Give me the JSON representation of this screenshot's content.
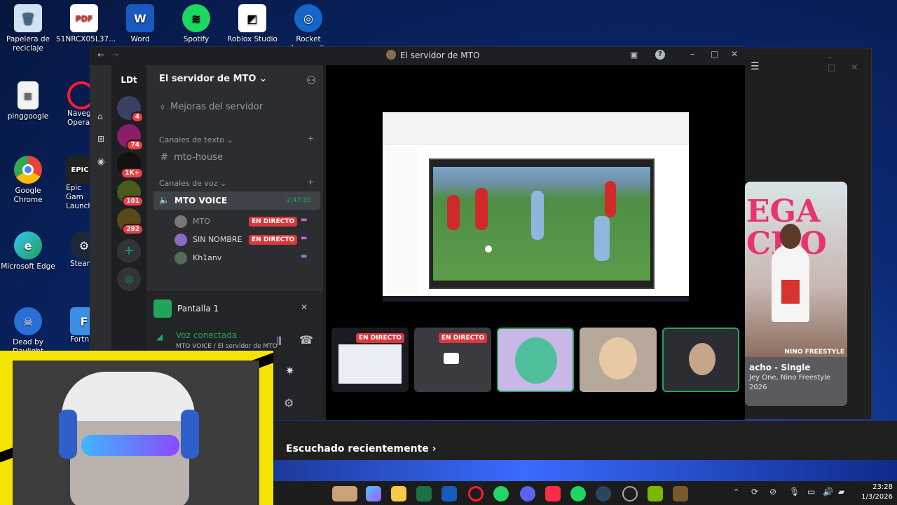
{
  "desktop": {
    "icons": [
      {
        "label": "Papelera de reciclaje"
      },
      {
        "label": "S1NRCX05L37..."
      },
      {
        "label": "Word"
      },
      {
        "label": "Spotify"
      },
      {
        "label": "Roblox Studio"
      },
      {
        "label": "Rocket League®"
      },
      {
        "label": "pinggoogle"
      },
      {
        "label": "Navega Opera"
      },
      {
        "label": "Google Chrome"
      },
      {
        "label": "Epic Gam Launch"
      },
      {
        "label": "Microsoft Edge"
      },
      {
        "label": "Steam"
      },
      {
        "label": "Dead by Daylight"
      },
      {
        "label": "Fortni"
      }
    ],
    "pdf_tag": "PDF"
  },
  "discord": {
    "window_title": "El servidor de MTO",
    "server_name": "El servidor de MTO",
    "boost": "Mejoras del servidor",
    "text_category": "Canales de texto",
    "text_channel": "mto-house",
    "voice_category": "Canales de voz",
    "voice_channel": "MTO VOICE",
    "voice_timer": "2:47:35",
    "users": [
      {
        "name": "MTO",
        "live": "EN DIRECTO"
      },
      {
        "name": "SIN NOMBRE",
        "live": "EN DIRECTO"
      },
      {
        "name": "Kh1anv",
        "live": ""
      }
    ],
    "servers": [
      {
        "label": "LDt",
        "badge": ""
      },
      {
        "label": "",
        "badge": "4"
      },
      {
        "label": "",
        "badge": "74"
      },
      {
        "label": "",
        "badge": "1K+"
      },
      {
        "label": "",
        "badge": "101"
      },
      {
        "label": "",
        "badge": "292"
      }
    ],
    "screen_panel": "Pantalla 1",
    "voice_status": "Voz conectada",
    "voice_location": "MTO VOICE / El servidor de MTO",
    "tiles": [
      {
        "live": "EN DIRECTO"
      },
      {
        "live": "EN DIRECTO"
      },
      {
        "live": ""
      },
      {
        "live": ""
      },
      {
        "live": ""
      }
    ]
  },
  "music": {
    "cover_title": "EGA CHO",
    "cover_artist": "NINO FREESTYLE",
    "track": "acho - Single",
    "artists": "Jey One, Nino Freestyle",
    "year": "2026",
    "recent": "Escuchado recientemente"
  },
  "taskbar": {
    "time": "23:28",
    "date": "1/3/2026"
  }
}
